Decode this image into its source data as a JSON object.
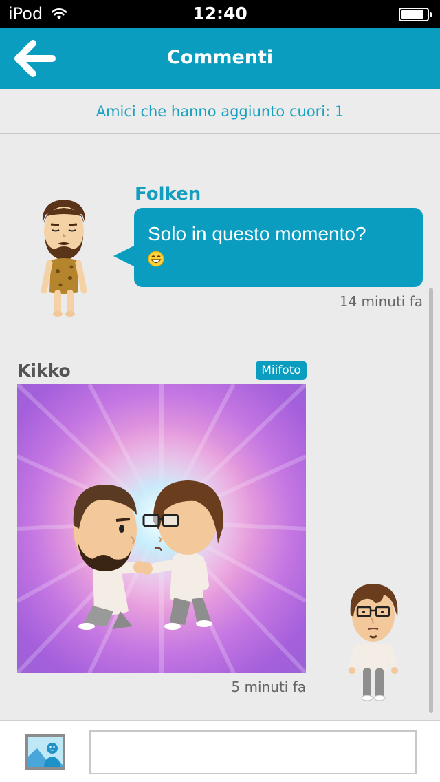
{
  "status_bar": {
    "carrier": "iPod",
    "time": "12:40"
  },
  "header": {
    "title": "Commenti",
    "accent_color": "#0a9dc0"
  },
  "hearts_summary": "Amici che hanno aggiunto cuori: 1",
  "comments": [
    {
      "author": "Folken",
      "text": "Solo in questo momento?",
      "emoji": "sweat-smile-emoji",
      "time": "14 minuti fa"
    },
    {
      "author": "Kikko",
      "badge": "Miifoto",
      "time": "5 minuti fa"
    }
  ],
  "composer": {
    "placeholder": ""
  },
  "icons": [
    "back-arrow-icon",
    "wifi-icon",
    "battery-icon",
    "photo-attach-icon"
  ]
}
